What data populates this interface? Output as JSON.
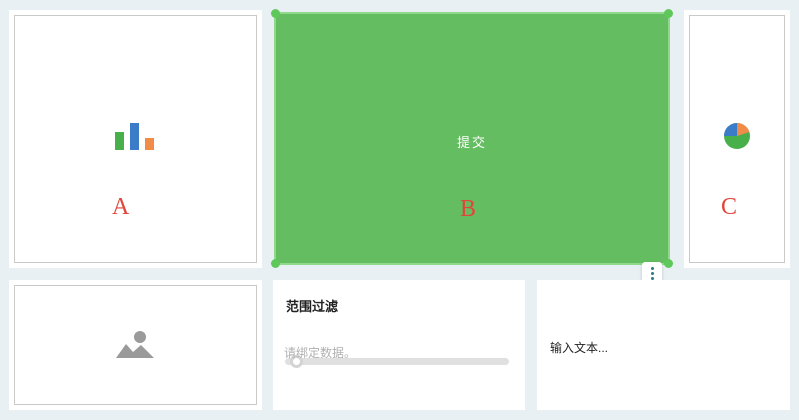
{
  "cards": {
    "a": {
      "letter": "A",
      "icon": "bar-chart-icon"
    },
    "b": {
      "letter": "B",
      "button_label": "提交"
    },
    "c": {
      "letter": "C",
      "icon": "pie-chart-icon"
    },
    "image": {
      "icon": "image-icon"
    },
    "range_filter": {
      "title": "范围过滤",
      "placeholder": "请绑定数据。"
    },
    "text_input": {
      "value": "输入文本..."
    }
  },
  "colors": {
    "selected_fill": "#64be61",
    "letter": "#e0463a",
    "bar_green": "#47b04a",
    "bar_blue": "#3a7cc8",
    "bar_orange": "#f08c47"
  }
}
